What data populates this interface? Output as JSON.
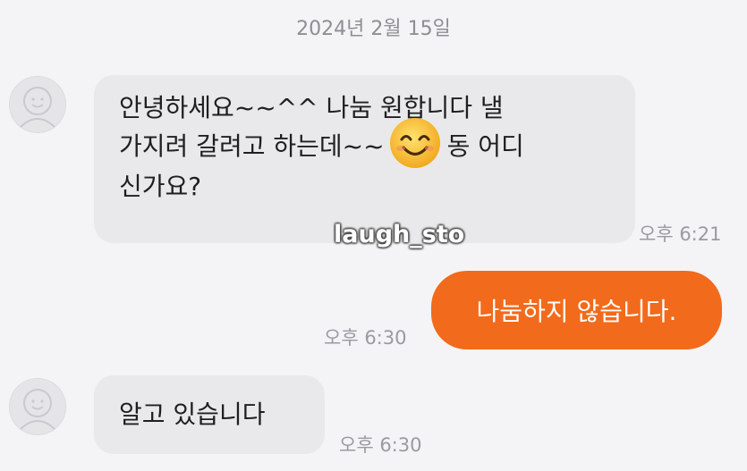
{
  "date_header": "2024년 2월 15일",
  "watermark": "laugh_sto",
  "messages": [
    {
      "sender": "other",
      "lines": [
        "안녕하세요~~^^ 나눔 원합니다 낼",
        "가지려 갈려고 하는데~~",
        "동 어디",
        "신가요?"
      ],
      "emoji": "smiling-face",
      "time": "오후 6:21"
    },
    {
      "sender": "me",
      "text": "나눔하지 않습니다.",
      "time": "오후 6:30"
    },
    {
      "sender": "other",
      "text": "알고 있습니다",
      "time": "오후 6:30"
    }
  ],
  "colors": {
    "outgoing_bubble": "#f26a1b",
    "incoming_bubble": "#e9e9ec",
    "background": "#f4f4f6"
  }
}
